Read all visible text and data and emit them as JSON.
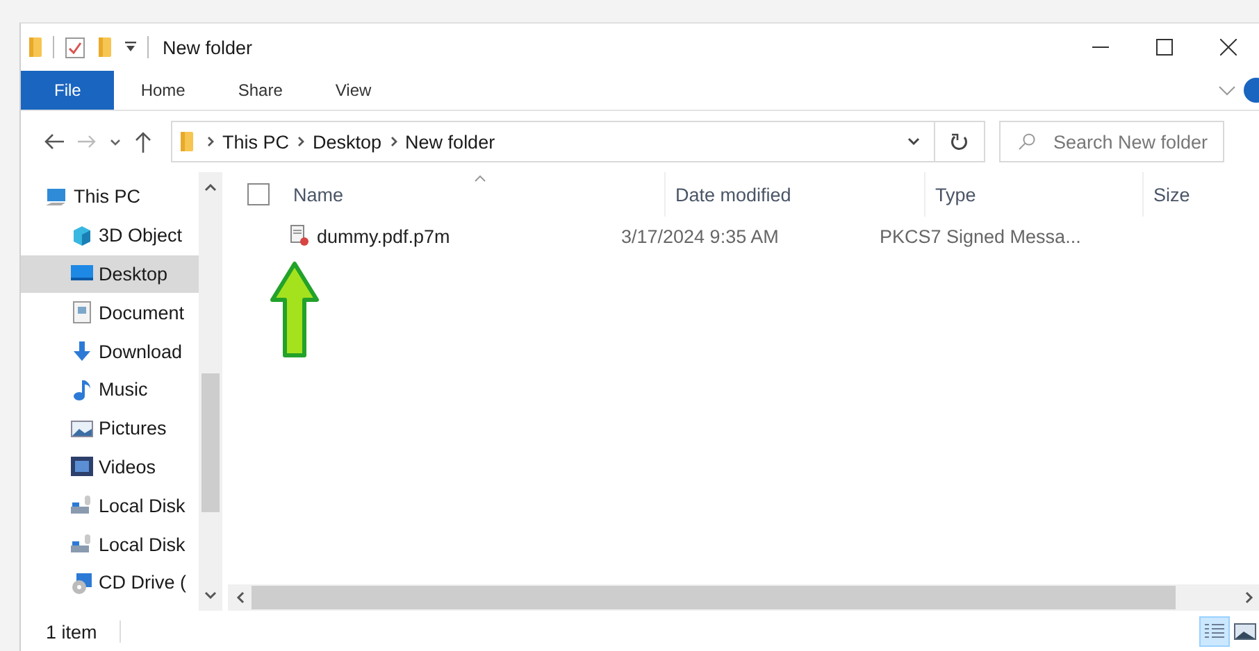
{
  "window": {
    "title": "New folder"
  },
  "ribbon_tabs": [
    {
      "label": "File",
      "selected": true
    },
    {
      "label": "Home",
      "selected": false
    },
    {
      "label": "Share",
      "selected": false
    },
    {
      "label": "View",
      "selected": false
    }
  ],
  "address": {
    "path": [
      "This PC",
      "Desktop",
      "New folder"
    ]
  },
  "search": {
    "placeholder": "Search New folder"
  },
  "sidebar": {
    "items": [
      {
        "label": "This PC",
        "selected": false,
        "kind": "pc",
        "children": [
          {
            "label": "3D Object",
            "selected": false,
            "kind": "cube"
          },
          {
            "label": "Desktop",
            "selected": true,
            "kind": "desktop"
          },
          {
            "label": "Document",
            "selected": false,
            "kind": "document"
          },
          {
            "label": "Download",
            "selected": false,
            "kind": "download"
          },
          {
            "label": "Music",
            "selected": false,
            "kind": "music"
          },
          {
            "label": "Pictures",
            "selected": false,
            "kind": "pictures"
          },
          {
            "label": "Videos",
            "selected": false,
            "kind": "videos"
          },
          {
            "label": "Local Disk",
            "selected": false,
            "kind": "disk"
          },
          {
            "label": "Local Disk",
            "selected": false,
            "kind": "disk"
          },
          {
            "label": "CD Drive (",
            "selected": false,
            "kind": "cd"
          }
        ]
      }
    ]
  },
  "table": {
    "select_all": {
      "checked": false
    },
    "columns": [
      "Name",
      "Date modified",
      "Type",
      "Size"
    ],
    "rows": [
      {
        "name": "dummy.pdf.p7m",
        "date_modified": "3/17/2024 9:35 AM",
        "type": "PKCS7 Signed Messa...",
        "selected": false
      }
    ]
  },
  "status_bar": {
    "text": "1 item"
  },
  "view_buttons": [
    {
      "kind": "details",
      "selected": true
    },
    {
      "kind": "thumbnails",
      "selected": false
    }
  ]
}
